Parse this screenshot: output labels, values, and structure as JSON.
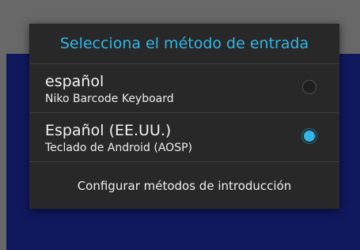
{
  "dialog": {
    "title": "Selecciona el método de entrada",
    "accent_color": "#33b5e5",
    "options": [
      {
        "name": "español",
        "subtitle": "Niko Barcode Keyboard",
        "selected": false
      },
      {
        "name": "Español (EE.UU.)",
        "subtitle": "Teclado de Android (AOSP)",
        "selected": true
      }
    ],
    "configure_label": "Configurar métodos de introducción"
  }
}
